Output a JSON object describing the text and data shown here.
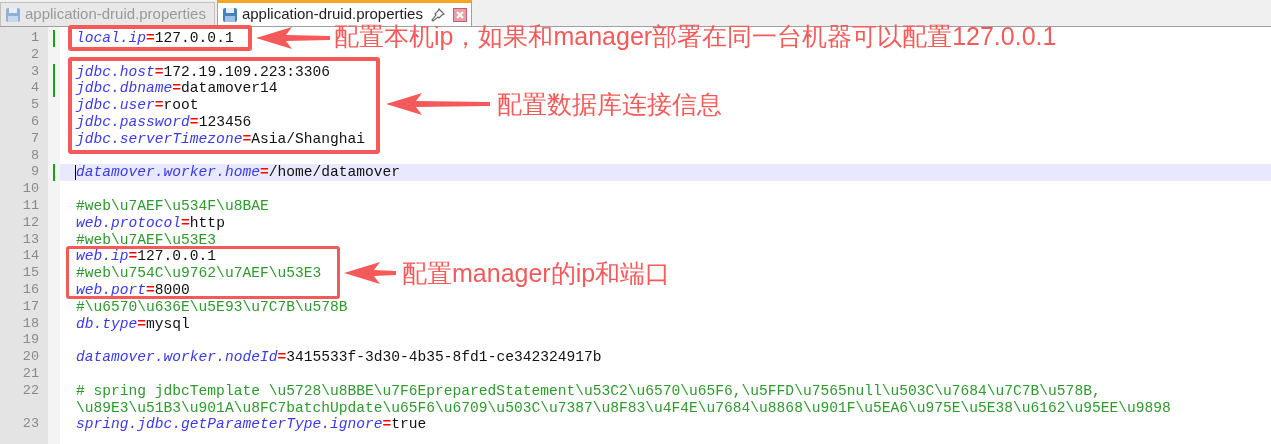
{
  "tabs": [
    {
      "label": "application-druid.properties",
      "selected": false
    },
    {
      "label": "application-druid.properties",
      "selected": true
    }
  ],
  "lines": [
    {
      "number": "1",
      "kind": "property",
      "key": "local.ip",
      "sep": "=",
      "value": "127.0.0.1",
      "modified": true,
      "current": false
    },
    {
      "number": "2",
      "kind": "blank",
      "modified": false,
      "current": false
    },
    {
      "number": "3",
      "kind": "property",
      "key": "jdbc.host",
      "sep": "=",
      "value": "172.19.109.223:3306",
      "modified": true,
      "current": false
    },
    {
      "number": "4",
      "kind": "property",
      "key": "jdbc.dbname",
      "sep": "=",
      "value": "datamover14",
      "modified": true,
      "current": false
    },
    {
      "number": "5",
      "kind": "property",
      "key": "jdbc.user",
      "sep": "=",
      "value": "root",
      "modified": false,
      "current": false
    },
    {
      "number": "6",
      "kind": "property",
      "key": "jdbc.password",
      "sep": "=",
      "value": "123456",
      "modified": false,
      "current": false
    },
    {
      "number": "7",
      "kind": "property",
      "key": "jdbc.serverTimezone",
      "sep": "=",
      "value": "Asia/Shanghai",
      "modified": false,
      "current": false
    },
    {
      "number": "8",
      "kind": "blank",
      "modified": false,
      "current": false
    },
    {
      "number": "9",
      "kind": "property",
      "key": "datamover.worker.home",
      "sep": "=",
      "value": "/home/datamover",
      "modified": true,
      "current": true
    },
    {
      "number": "10",
      "kind": "blank",
      "modified": false,
      "current": false
    },
    {
      "number": "11",
      "kind": "comment",
      "text": [
        "#web\\u7AEF\\u534F\\u8BAE"
      ],
      "modified": false,
      "current": false
    },
    {
      "number": "12",
      "kind": "property",
      "key": "web.protocol",
      "sep": "=",
      "value": "http",
      "modified": false,
      "current": false
    },
    {
      "number": "13",
      "kind": "comment",
      "text": [
        "#web\\u7AEF\\u53E3"
      ],
      "modified": false,
      "current": false
    },
    {
      "number": "14",
      "kind": "property",
      "key": "web.ip",
      "sep": "=",
      "value": "127.0.0.1",
      "modified": false,
      "current": false
    },
    {
      "number": "15",
      "kind": "comment",
      "text": [
        "#web\\u754C\\u9762\\u7AEF\\u53E3"
      ],
      "modified": false,
      "current": false
    },
    {
      "number": "16",
      "kind": "property",
      "key": "web.port",
      "sep": "=",
      "value": "8000",
      "modified": false,
      "current": false
    },
    {
      "number": "17",
      "kind": "comment",
      "text": [
        "#\\u6570\\u636E\\u5E93\\u7C7B\\u578B"
      ],
      "modified": false,
      "current": false
    },
    {
      "number": "18",
      "kind": "property",
      "key": "db.type",
      "sep": "=",
      "value": "mysql",
      "modified": false,
      "current": false
    },
    {
      "number": "19",
      "kind": "blank",
      "modified": false,
      "current": false
    },
    {
      "number": "20",
      "kind": "property",
      "key": "datamover.worker.nodeId",
      "sep": "=",
      "value": "3415533f-3d30-4b35-8fd1-ce342324917b",
      "modified": false,
      "current": false
    },
    {
      "number": "21",
      "kind": "blank",
      "modified": false,
      "current": false
    },
    {
      "number": "22",
      "kind": "comment",
      "text": [
        "# spring jdbcTemplate \\u5728\\u8BBE\\u7F6EpreparedStatement\\u53C2\\u6570\\u65F6,\\u5FFD\\u7565null\\u503C\\u7684\\u7C7B\\u578B,",
        "\\u89E3\\u51B3\\u901A\\u8FC7batchUpdate\\u65F6\\u6709\\u503C\\u7387\\u8F83\\u4F4E\\u7684\\u8868\\u901F\\u5EA6\\u975E\\u5E38\\u6162\\u95EE\\u9898"
      ],
      "modified": false,
      "current": false
    },
    {
      "number": "23",
      "kind": "property",
      "key": "spring.jdbc.getParameterType.ignore",
      "sep": "=",
      "value": "true",
      "modified": false,
      "current": false
    }
  ],
  "annotations": [
    {
      "text": "配置本机ip，如果和manager部署在同一台机器可以配置127.0.0.1"
    },
    {
      "text": "配置数据库连接信息"
    },
    {
      "text": "配置manager的ip和端口"
    }
  ]
}
